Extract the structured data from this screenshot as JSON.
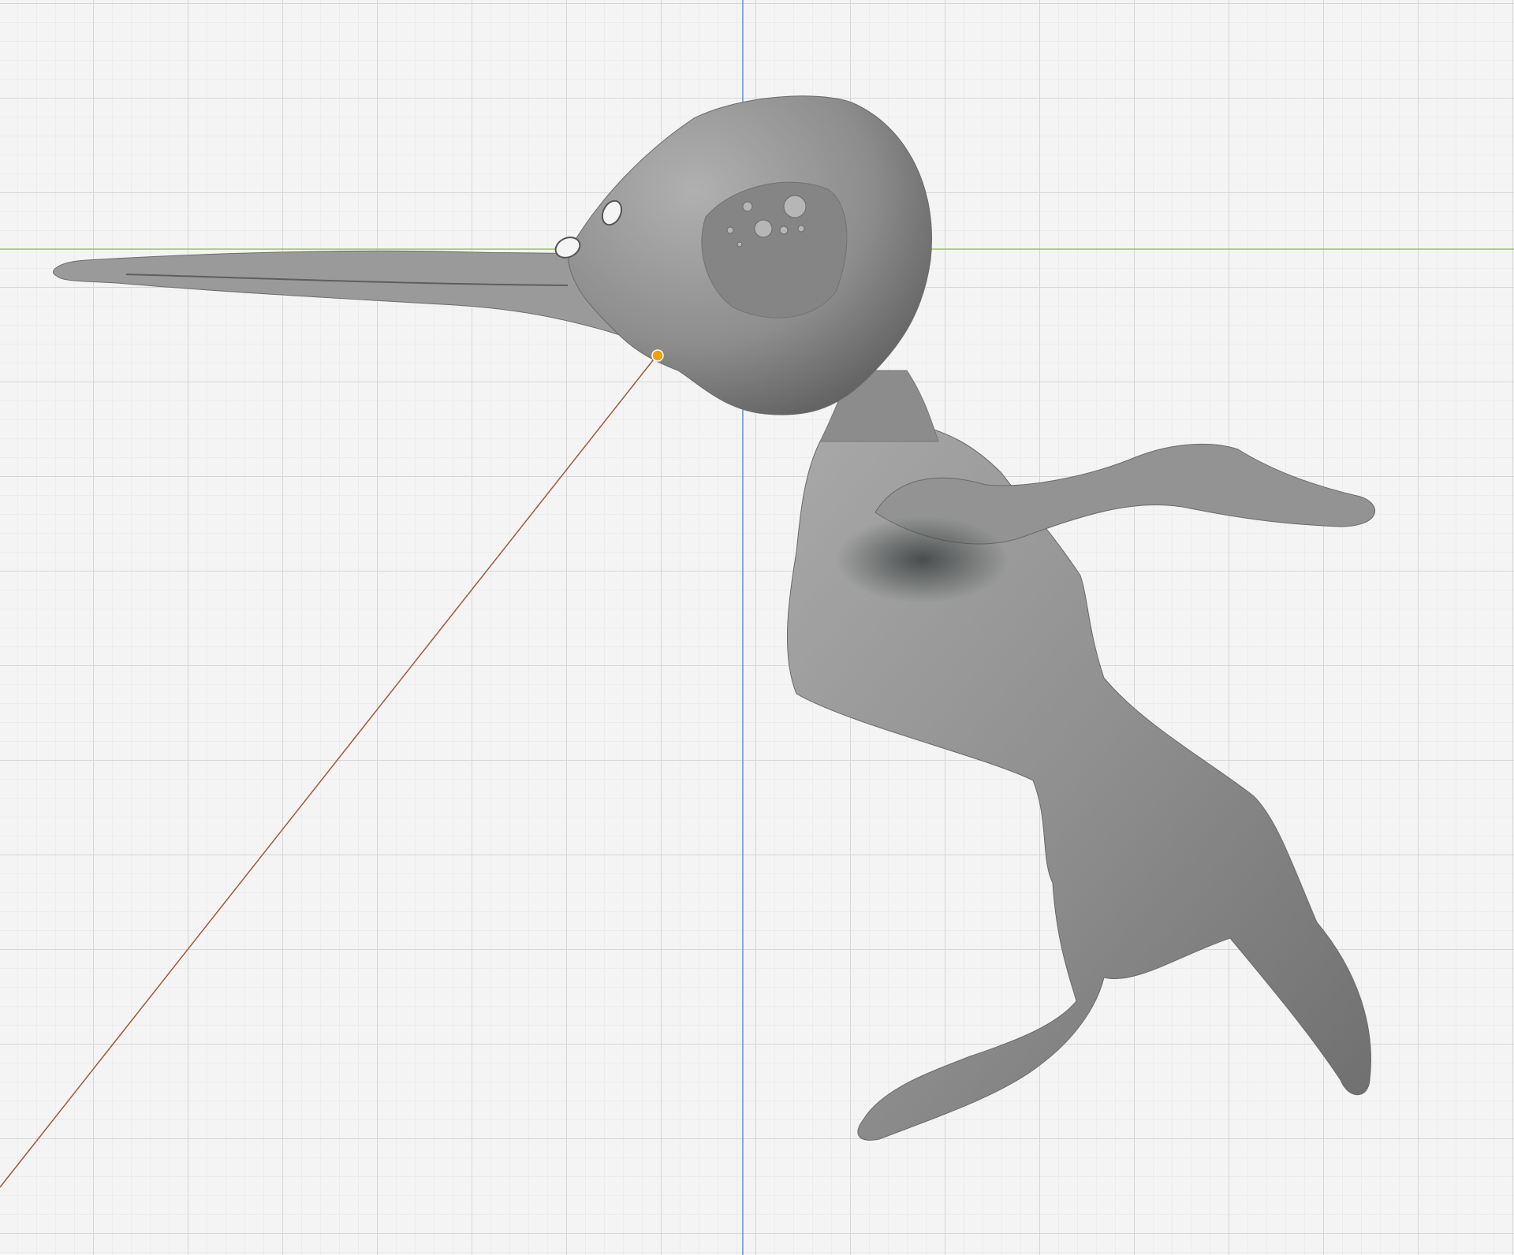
{
  "viewport": {
    "background_color": "#f4f4f4",
    "grid_minor_color": "#ececec",
    "grid_major_color": "#d6d6d6",
    "axis_x_color": "#9cc16a",
    "axis_z_color": "#6d8fc9",
    "guide_line_color": "#9a5a3a",
    "object_origin_color": "#f2a100",
    "mesh_color": "#8e8e8e",
    "grid_visible": true
  },
  "scene_object": {
    "type": "sculpted-mesh",
    "shape": "bird-like creature with long beak",
    "selected": true
  }
}
